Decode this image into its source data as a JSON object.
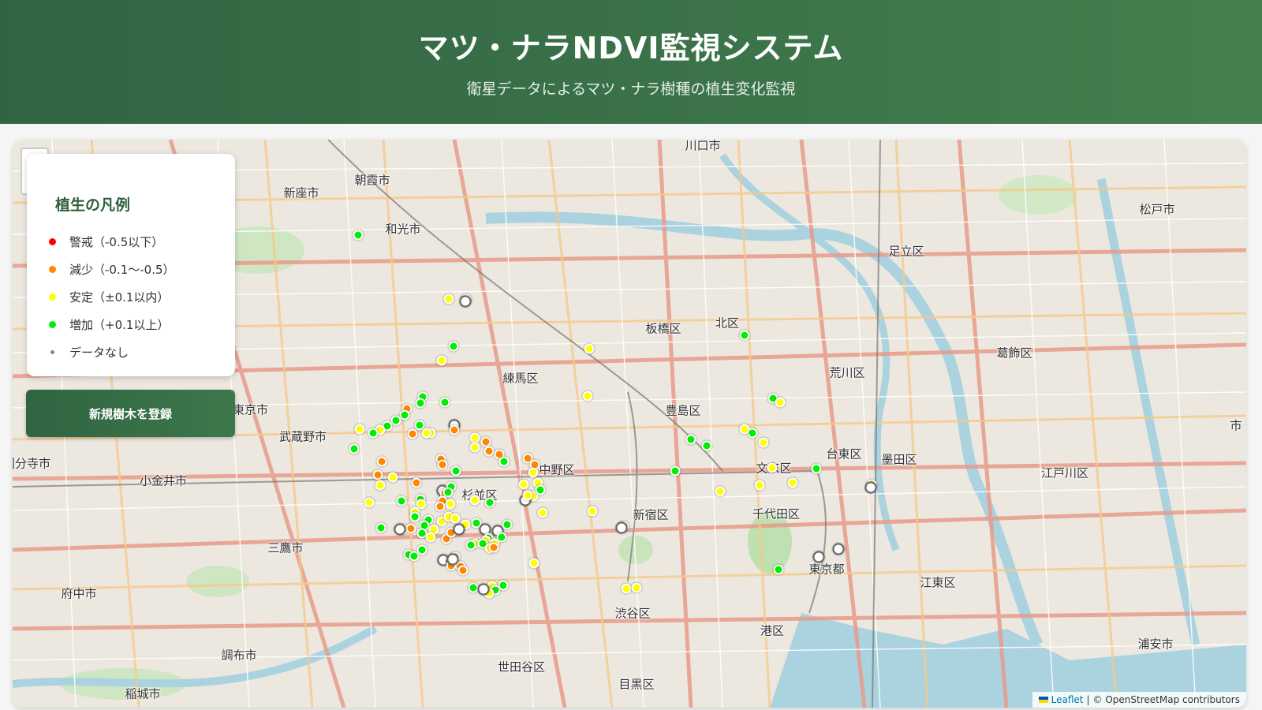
{
  "header": {
    "title": "マツ・ナラNDVI監視システム",
    "subtitle": "衛星データによるマツ・ナラ樹種の植生変化監視"
  },
  "legend": {
    "title": "植生の凡例",
    "items": [
      {
        "label": "警戒（-0.5以下）",
        "color": "#ff0000"
      },
      {
        "label": "減少（-0.1〜-0.5）",
        "color": "#ff8800"
      },
      {
        "label": "安定（±0.1以内）",
        "color": "#ffff00"
      },
      {
        "label": "増加（+0.1以上）",
        "color": "#00ee00"
      },
      {
        "label": "データなし",
        "color": "#888888"
      }
    ]
  },
  "register_button": "新規樹木を登録",
  "attribution": {
    "leaflet": "Leaflet",
    "separator": "|",
    "osm": "© OpenStreetMap contributors"
  },
  "places": [
    "川口市",
    "朝霞市",
    "新座市",
    "和光市",
    "足立区",
    "松戸市",
    "板橋区",
    "北区",
    "荒川区",
    "葛飾区",
    "練馬区",
    "豊島区",
    "西東京市",
    "武蔵野市",
    "文京区",
    "台東区",
    "墨田区",
    "江戸川区",
    "小金井市",
    "杉並区",
    "中野区",
    "新宿区",
    "千代田区",
    "三鷹市",
    "府中市",
    "東京都",
    "江東区",
    "港区",
    "渋谷区",
    "調布市",
    "世田谷区",
    "目黒区",
    "浦安市",
    "稲城市",
    "国分寺市",
    "市"
  ],
  "status_colors": {
    "alert": "#ff0000",
    "decrease": "#ff8800",
    "stable": "#ffff00",
    "increase": "#00ee00",
    "nodata": "#888888"
  },
  "tree_counts": {
    "increase": 50,
    "stable": 51,
    "decrease": 40,
    "nodata": 17
  }
}
